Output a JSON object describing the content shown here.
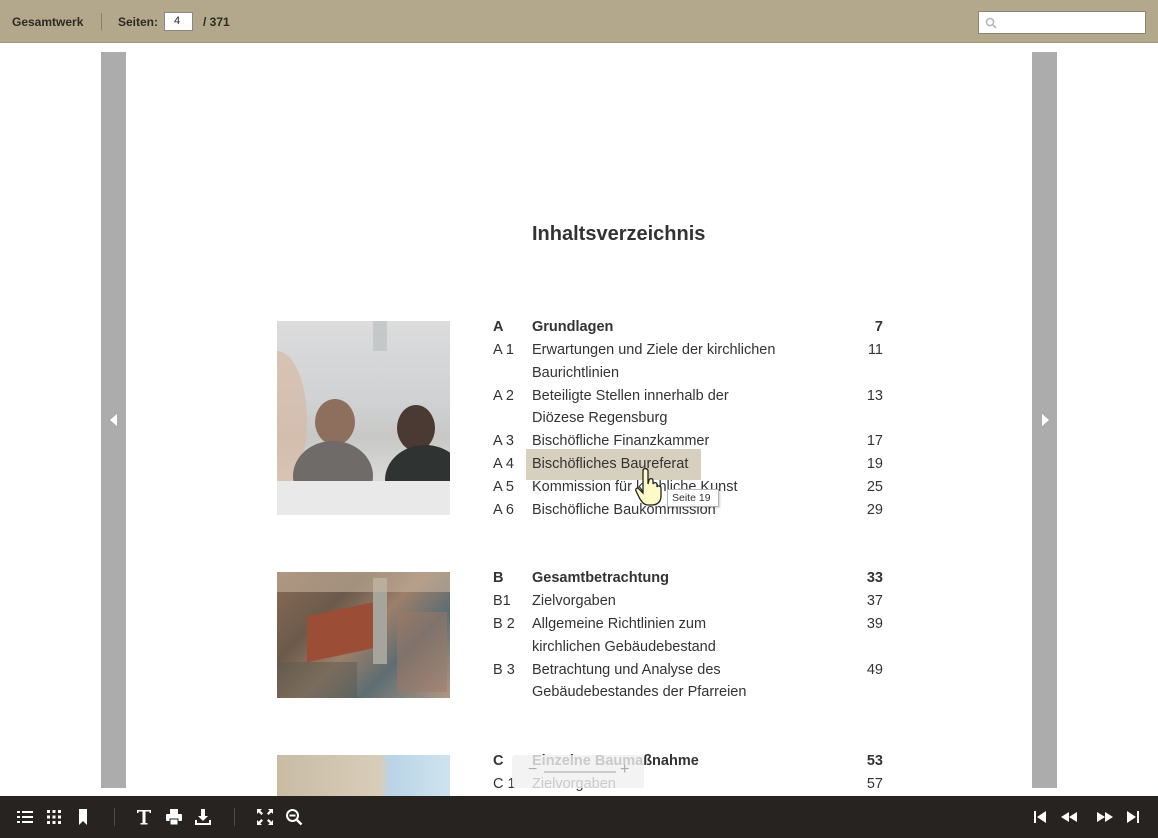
{
  "topbar": {
    "work_label": "Gesamtwerk",
    "pages_label": "Seiten:",
    "current_page": "4",
    "total_pages": "/ 371",
    "search_placeholder": ""
  },
  "page": {
    "title": "Inhaltsverzeichnis",
    "toc": [
      {
        "code": "A",
        "label": "Grundlagen",
        "page": "7",
        "bold": true
      },
      {
        "code": "A 1",
        "label": "Erwartungen und Ziele der kirchlichen",
        "label2": "Baurichtlinien",
        "page": "11"
      },
      {
        "code": "A 2",
        "label": "Beteiligte Stellen innerhalb der",
        "label2": "Diözese Regensburg",
        "page": "13"
      },
      {
        "code": "A 3",
        "label": "Bischöfliche Finanzkammer",
        "page": "17"
      },
      {
        "code": "A 4",
        "label": "Bischöfliches Baureferat",
        "page": "19"
      },
      {
        "code": "A 5",
        "label": "Kommission für kirchliche Kunst",
        "page": "25"
      },
      {
        "code": "A 6",
        "label": "Bischöfliche Baukommission",
        "page": "29"
      },
      {
        "code": "B",
        "label": "Gesamtbetrachtung",
        "page": "33",
        "bold": true
      },
      {
        "code": "B1",
        "label": "Zielvorgaben",
        "page": "37"
      },
      {
        "code": "B 2",
        "label": "Allgemeine Richtlinien zum",
        "label2": "kirchlichen Gebäudebestand",
        "page": "39"
      },
      {
        "code": "B 3",
        "label": "Betrachtung und Analyse des",
        "label2": "Gebäudebestandes der Pfarreien",
        "page": "49"
      },
      {
        "code": "C",
        "label": "Einzelne Baumaßnahme",
        "page": "53",
        "bold": true
      },
      {
        "code": "C 1",
        "label": "Zielvorgaben",
        "page": "57"
      }
    ],
    "tooltip": "Seite 19",
    "zoom_minus": "−",
    "zoom_plus": "+"
  },
  "bottombar": {
    "icons": [
      "toc-list-icon",
      "thumbnails-grid-icon",
      "bookmark-icon",
      "text-icon",
      "print-icon",
      "download-icon",
      "fullscreen-icon",
      "zoom-out-icon",
      "first-page-icon",
      "previous-page-icon",
      "next-page-icon",
      "last-page-icon"
    ]
  },
  "colors": {
    "topbar": "#b3a88c",
    "bottombar": "#262320",
    "highlight": "#d8d0bf",
    "flip_bar": "#acacac"
  }
}
